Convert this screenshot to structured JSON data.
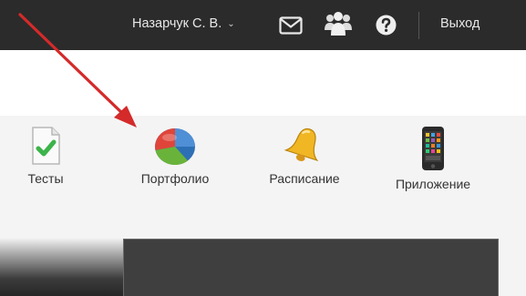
{
  "header": {
    "user_name": "Назарчук С. В.",
    "user_caret": "⌄",
    "logout_label": "Выход",
    "icons": [
      "mail-icon",
      "people-icon",
      "help-icon"
    ]
  },
  "modules": [
    {
      "label": "Тесты",
      "icon": "test-check-icon"
    },
    {
      "label": "Портфолио",
      "icon": "pie-chart-icon"
    },
    {
      "label": "Расписание",
      "icon": "bell-icon"
    },
    {
      "label": "Приложение",
      "icon": "phone-icon"
    }
  ],
  "colors": {
    "topbar": "#2b2b2b",
    "arrow": "#d42a2a",
    "panel": "#f4f4f4"
  }
}
